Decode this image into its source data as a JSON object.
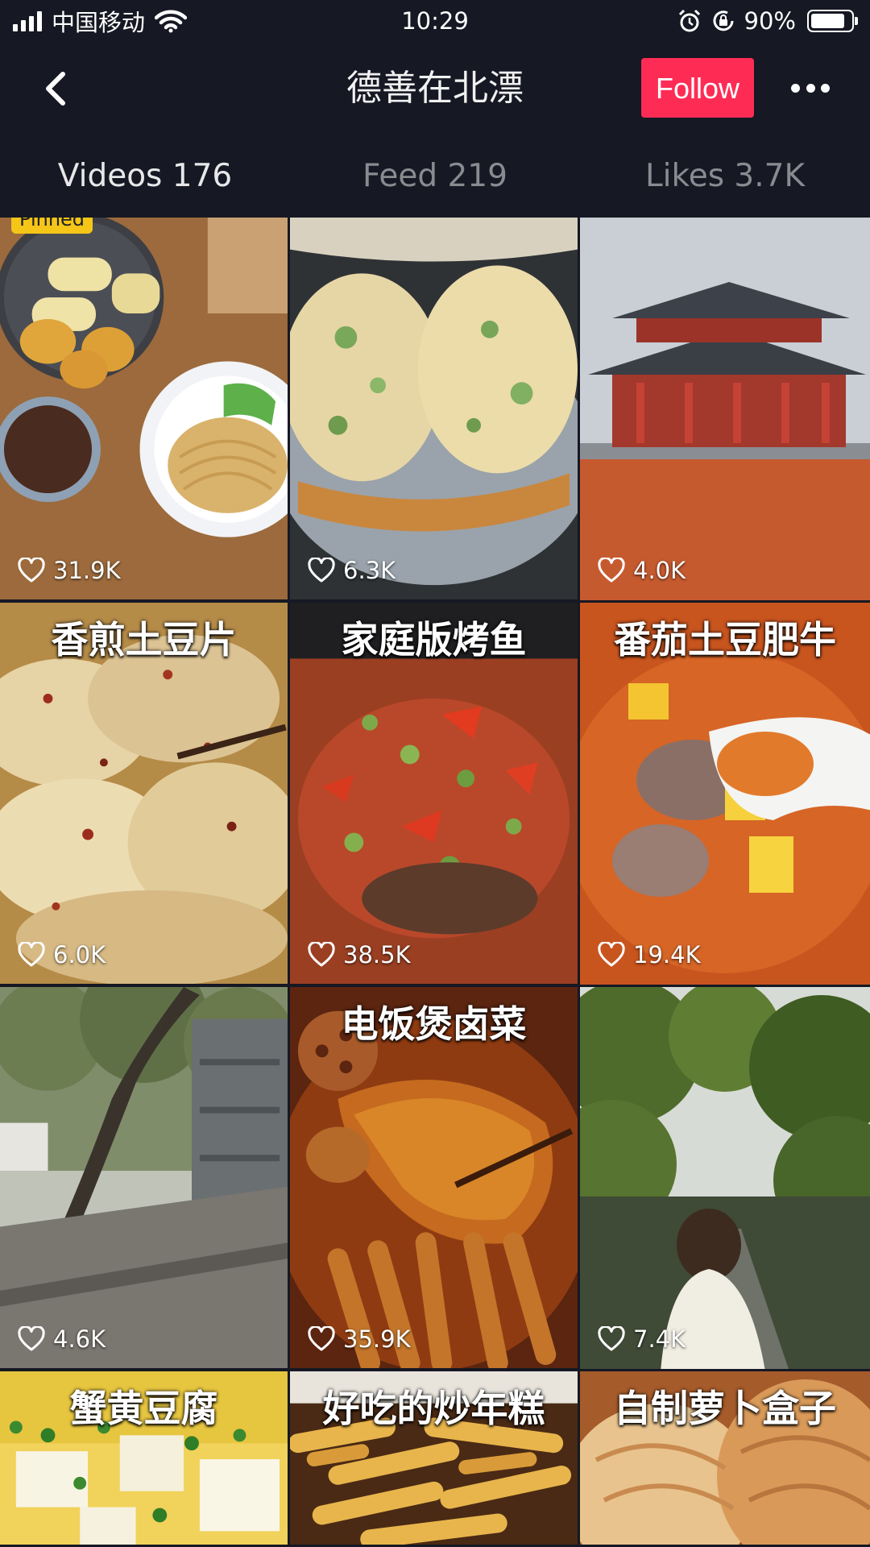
{
  "status_bar": {
    "carrier": "中国移动",
    "time": "10:29",
    "battery": "90%",
    "battery_level": 0.9
  },
  "header": {
    "title": "德善在北漂",
    "follow_label": "Follow"
  },
  "tabs": [
    {
      "label": "Videos 176",
      "active": true
    },
    {
      "label": "Feed 219",
      "active": false
    },
    {
      "label": "Likes 3.7K",
      "active": false
    }
  ],
  "videos": [
    {
      "likes": "31.9K",
      "title": "",
      "pinned": "Pinned",
      "scene": "breakfast"
    },
    {
      "likes": "6.3K",
      "title": "",
      "scene": "pancake"
    },
    {
      "likes": "4.0K",
      "title": "",
      "scene": "palace"
    },
    {
      "likes": "6.0K",
      "title": "香煎土豆片",
      "scene": "potato"
    },
    {
      "likes": "38.5K",
      "title": "家庭版烤鱼",
      "scene": "fish"
    },
    {
      "likes": "19.4K",
      "title": "番茄土豆肥牛",
      "scene": "beef"
    },
    {
      "likes": "4.6K",
      "title": "",
      "scene": "street"
    },
    {
      "likes": "35.9K",
      "title": "电饭煲卤菜",
      "scene": "braised"
    },
    {
      "likes": "7.4K",
      "title": "",
      "scene": "park"
    },
    {
      "likes": "",
      "title": "蟹黄豆腐",
      "scene": "tofu"
    },
    {
      "likes": "",
      "title": "好吃的炒年糕",
      "scene": "ricecake"
    },
    {
      "likes": "",
      "title": "自制萝卜盒子",
      "scene": "pie"
    }
  ],
  "colors": {
    "background": "#161823",
    "follow": "#fe2c55",
    "tab_indicator": "#f5c518"
  },
  "icons": {
    "back": "chevron-left-icon",
    "more": "more-dots-icon",
    "like": "heart-outline-icon",
    "wifi": "wifi-icon",
    "alarm": "alarm-icon",
    "lock": "rotation-lock-icon"
  }
}
